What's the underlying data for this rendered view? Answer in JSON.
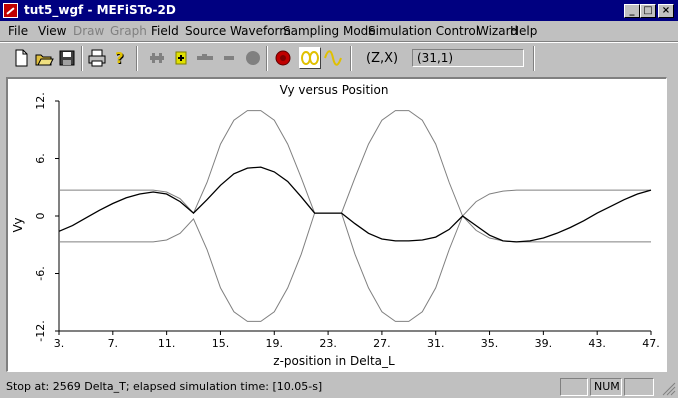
{
  "window": {
    "title": "tut5_wgf - MEFiSTo-2D"
  },
  "menu": [
    {
      "label": "File",
      "enabled": true
    },
    {
      "label": "View",
      "enabled": true
    },
    {
      "label": "Draw",
      "enabled": false
    },
    {
      "label": "Graph",
      "enabled": false
    },
    {
      "label": "Field",
      "enabled": true
    },
    {
      "label": "Source Waveform",
      "enabled": true
    },
    {
      "label": "Sampling Mode",
      "enabled": true
    },
    {
      "label": "Simulation Control",
      "enabled": true
    },
    {
      "label": "Wizard",
      "enabled": true
    },
    {
      "label": "Help",
      "enabled": true
    }
  ],
  "toolbar": {
    "buttons": [
      "new-file-icon",
      "open-folder-icon",
      "save-disk-icon",
      "print-icon",
      "help-question-icon",
      "plus-cross-icon",
      "plus-icon",
      "dash-long-icon",
      "minus-icon",
      "gray-circle-icon",
      "record-stop-icon",
      "two-loops-icon",
      "sine-wave-icon"
    ],
    "coord_label": "(Z,X)",
    "coord_value": "(31,1)"
  },
  "status": {
    "text": "Stop at: 2569 Delta_T;   elapsed simulation time: [10.05-s]",
    "num": "NUM"
  },
  "chart_data": {
    "type": "line",
    "title": "Vy versus Position",
    "xlabel": "z-position in Delta_L",
    "ylabel": "Vy",
    "xlim": [
      3,
      47
    ],
    "ylim": [
      -12,
      12
    ],
    "x_ticks": [
      "3.",
      "7.",
      "11.",
      "15.",
      "19.",
      "23.",
      "27.",
      "31.",
      "35.",
      "39.",
      "43.",
      "47."
    ],
    "y_ticks": [
      "12.",
      "6.",
      "0",
      "-6.",
      "-12."
    ],
    "series": [
      {
        "color": "#000000",
        "values": [
          [
            3,
            -1.6
          ],
          [
            4,
            -1.0
          ],
          [
            5,
            -0.2
          ],
          [
            6,
            0.6
          ],
          [
            7,
            1.3
          ],
          [
            8,
            1.9
          ],
          [
            9,
            2.3
          ],
          [
            10,
            2.5
          ],
          [
            11,
            2.3
          ],
          [
            12,
            1.5
          ],
          [
            13,
            0.3
          ],
          [
            14,
            1.7
          ],
          [
            15,
            3.2
          ],
          [
            16,
            4.4
          ],
          [
            17,
            5.0
          ],
          [
            18,
            5.1
          ],
          [
            19,
            4.6
          ],
          [
            20,
            3.6
          ],
          [
            21,
            2.0
          ],
          [
            22,
            0.3
          ],
          [
            23,
            0.3
          ],
          [
            24,
            0.3
          ],
          [
            25,
            -0.8
          ],
          [
            26,
            -1.8
          ],
          [
            27,
            -2.4
          ],
          [
            28,
            -2.6
          ],
          [
            29,
            -2.6
          ],
          [
            30,
            -2.5
          ],
          [
            31,
            -2.2
          ],
          [
            32,
            -1.4
          ],
          [
            33,
            0.0
          ],
          [
            34,
            -1.0
          ],
          [
            35,
            -2.0
          ],
          [
            36,
            -2.6
          ],
          [
            37,
            -2.7
          ],
          [
            38,
            -2.6
          ],
          [
            39,
            -2.3
          ],
          [
            40,
            -1.8
          ],
          [
            41,
            -1.2
          ],
          [
            42,
            -0.5
          ],
          [
            43,
            0.3
          ],
          [
            44,
            1.0
          ],
          [
            45,
            1.7
          ],
          [
            46,
            2.3
          ],
          [
            47,
            2.7
          ]
        ]
      },
      {
        "color": "#808080",
        "values": [
          [
            3,
            2.7
          ],
          [
            10,
            2.7
          ],
          [
            11,
            2.5
          ],
          [
            12,
            1.8
          ],
          [
            13,
            0.3
          ],
          [
            14,
            3.5
          ],
          [
            15,
            7.5
          ],
          [
            16,
            10.0
          ],
          [
            17,
            11.0
          ],
          [
            18,
            11.0
          ],
          [
            19,
            10.0
          ],
          [
            20,
            7.5
          ],
          [
            21,
            4.0
          ],
          [
            22,
            0.3
          ],
          [
            23,
            0.3
          ],
          [
            24,
            0.3
          ],
          [
            25,
            4.0
          ],
          [
            26,
            7.5
          ],
          [
            27,
            10.0
          ],
          [
            28,
            11.0
          ],
          [
            29,
            11.0
          ],
          [
            30,
            10.0
          ],
          [
            31,
            7.5
          ],
          [
            32,
            3.5
          ],
          [
            33,
            0.0
          ],
          [
            34,
            1.5
          ],
          [
            35,
            2.3
          ],
          [
            36,
            2.6
          ],
          [
            37,
            2.7
          ],
          [
            47,
            2.7
          ]
        ]
      },
      {
        "color": "#808080",
        "values": [
          [
            3,
            -2.7
          ],
          [
            10,
            -2.7
          ],
          [
            11,
            -2.5
          ],
          [
            12,
            -1.8
          ],
          [
            13,
            -0.3
          ],
          [
            14,
            -3.5
          ],
          [
            15,
            -7.5
          ],
          [
            16,
            -10.0
          ],
          [
            17,
            -11.0
          ],
          [
            18,
            -11.0
          ],
          [
            19,
            -10.0
          ],
          [
            20,
            -7.5
          ],
          [
            21,
            -4.0
          ],
          [
            22,
            0.3
          ],
          [
            23,
            0.3
          ],
          [
            24,
            0.3
          ],
          [
            25,
            -4.0
          ],
          [
            26,
            -7.5
          ],
          [
            27,
            -10.0
          ],
          [
            28,
            -11.0
          ],
          [
            29,
            -11.0
          ],
          [
            30,
            -10.0
          ],
          [
            31,
            -7.5
          ],
          [
            32,
            -3.5
          ],
          [
            33,
            0.0
          ],
          [
            34,
            -1.5
          ],
          [
            35,
            -2.3
          ],
          [
            36,
            -2.6
          ],
          [
            37,
            -2.7
          ],
          [
            47,
            -2.7
          ]
        ]
      }
    ]
  }
}
